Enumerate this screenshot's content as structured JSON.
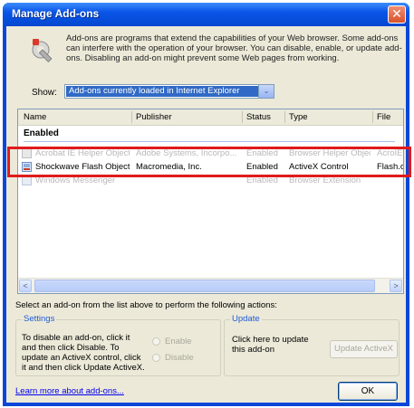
{
  "window": {
    "title": "Manage Add-ons",
    "close_glyph": "✕"
  },
  "intro": "Add-ons are programs that extend the capabilities of your Web browser. Some add-ons can interfere with the operation of your browser. You can disable, enable, or update add-ons. Disabling an add-on might prevent some Web pages from working.",
  "show": {
    "label": "Show:",
    "selected": "Add-ons currently loaded in Internet Explorer",
    "arrow": "⌄"
  },
  "table": {
    "columns": [
      "Name",
      "Publisher",
      "Status",
      "Type",
      "File"
    ],
    "group": "Enabled",
    "rows": [
      {
        "name": "Acrobat IE Helper Object",
        "publisher": "Adobe Systems, Incorpo...",
        "status": "Enabled",
        "type": "Browser Helper Object",
        "file": "AcroIEHelper.dll",
        "icon": "addon-icon"
      },
      {
        "name": "Shockwave Flash Object",
        "publisher": "Macromedia, Inc.",
        "status": "Enabled",
        "type": "ActiveX Control",
        "file": "Flash.ocx",
        "icon": "flash-addon-icon"
      },
      {
        "name": "Windows Messenger",
        "publisher": "",
        "status": "Enabled",
        "type": "Browser Extension",
        "file": "",
        "icon": "messenger-icon"
      }
    ],
    "scroll_left": "<",
    "scroll_right": ">"
  },
  "instruction": "Select an add-on from the list above to perform the following actions:",
  "settings": {
    "title": "Settings",
    "text": "To disable an add-on, click it and then click Disable. To update an ActiveX control, click it and then click Update ActiveX.",
    "enable_label": "Enable",
    "disable_label": "Disable"
  },
  "update": {
    "title": "Update",
    "text": "Click here to update this add-on",
    "button": "Update ActiveX"
  },
  "learn_more": "Learn more about add-ons...",
  "ok": "OK",
  "colors": {
    "highlight": "#e01b1b",
    "selection": "#316ac5",
    "titlebar": "#0a55e8"
  }
}
